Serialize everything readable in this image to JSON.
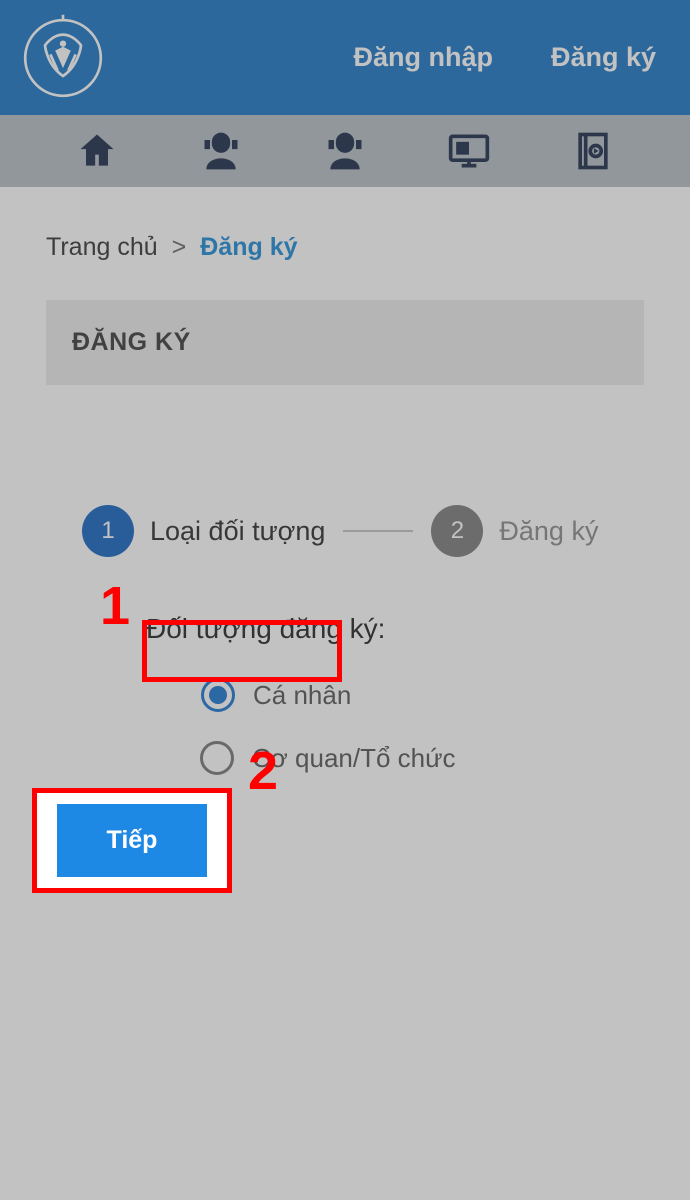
{
  "header": {
    "login_label": "Đăng nhập",
    "register_label": "Đăng ký",
    "logo_alt": "Bảo hiểm xã hội Việt Nam"
  },
  "breadcrumb": {
    "home": "Trang chủ",
    "sep": ">",
    "current": "Đăng ký"
  },
  "page_title": "ĐĂNG KÝ",
  "stepper": {
    "step1_num": "1",
    "step1_label": "Loại đối tượng",
    "step2_num": "2",
    "step2_label": "Đăng ký"
  },
  "form": {
    "label": "Đối tượng đăng ký:",
    "opt_individual": "Cá nhân",
    "opt_org": "Cơ quan/Tổ chức",
    "continue_btn": "Tiếp"
  },
  "annotations": {
    "num1": "1",
    "num2": "2"
  }
}
